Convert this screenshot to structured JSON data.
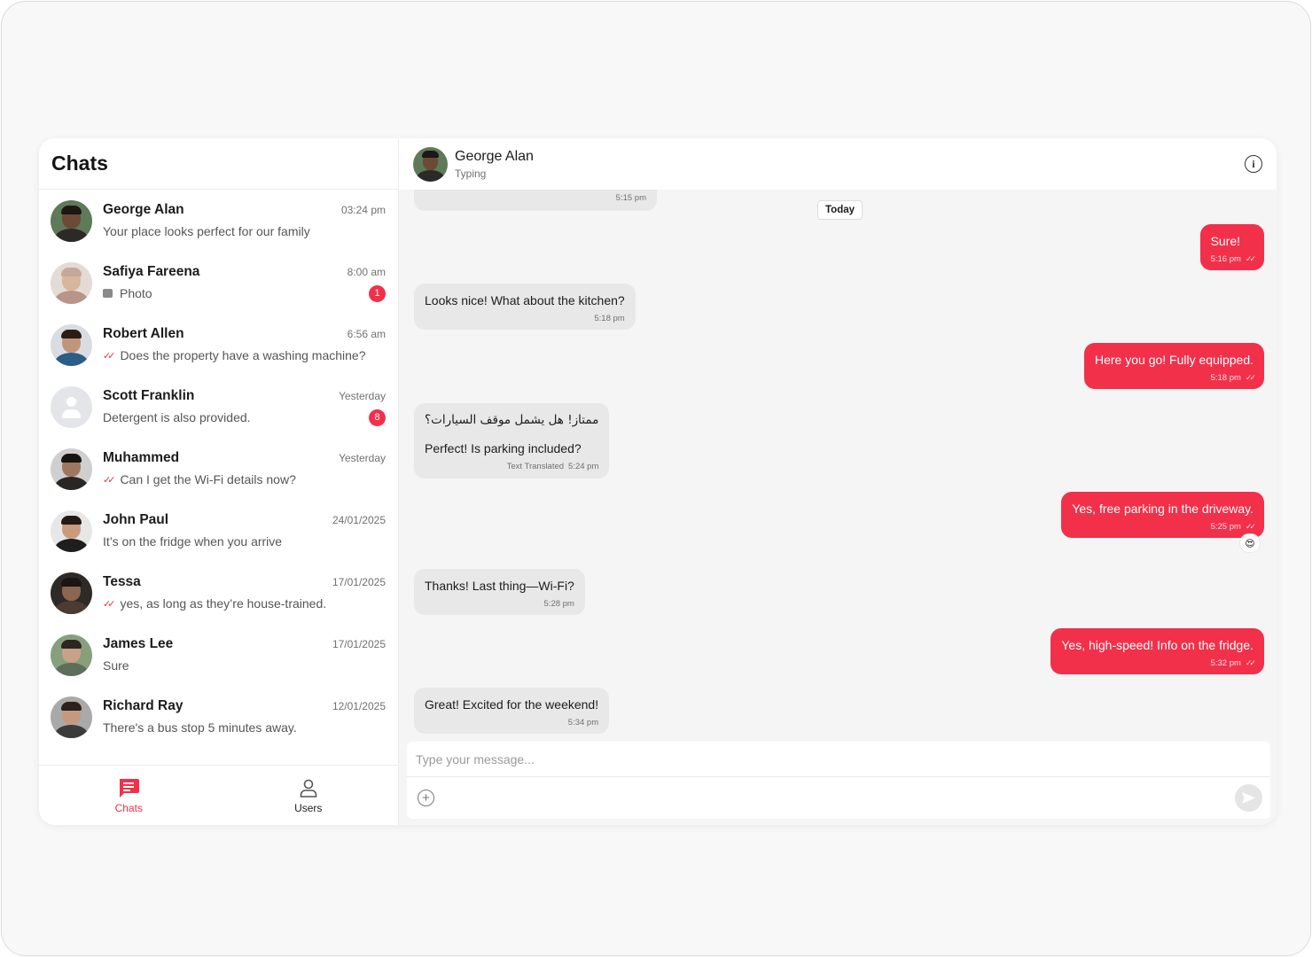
{
  "sidebar": {
    "title": "Chats",
    "chats": [
      {
        "name": "George Alan",
        "time": "03:24 pm",
        "preview": "Your place looks perfect for our family",
        "badge": "",
        "sent": false,
        "photo": false,
        "skin": "#6b4a36",
        "hair": "#1e1714",
        "shirt": "#2c2a28",
        "bg": "#5e7a58"
      },
      {
        "name": "Safiya Fareena",
        "time": "8:00 am",
        "preview": "Photo",
        "badge": "1",
        "sent": false,
        "photo": true,
        "skin": "#d8b59c",
        "hair": "#c7a79a",
        "shirt": "#b99589",
        "bg": "#e3dbd6"
      },
      {
        "name": "Robert Allen",
        "time": "6:56 am",
        "preview": "Does the property have a washing machine?",
        "badge": "",
        "sent": true,
        "photo": false,
        "skin": "#c0957a",
        "hair": "#2a1d16",
        "shirt": "#2b5d86",
        "bg": "#d9dde2"
      },
      {
        "name": "Scott Franklin",
        "time": "Yesterday",
        "preview": "Detergent is also provided.",
        "badge": "8",
        "sent": false,
        "photo": false,
        "placeholder": true
      },
      {
        "name": "Muhammed",
        "time": "Yesterday",
        "preview": "Can I get the Wi-Fi details now?",
        "badge": "",
        "sent": true,
        "photo": false,
        "skin": "#9e7761",
        "hair": "#171412",
        "shirt": "#2a2624",
        "bg": "#cfcfcf"
      },
      {
        "name": "John Paul",
        "time": "24/01/2025",
        "preview": "It’s on the fridge when you arrive",
        "badge": "",
        "sent": false,
        "photo": false,
        "skin": "#c99b7d",
        "hair": "#231a15",
        "shirt": "#1e1e1e",
        "bg": "#e7e7e7"
      },
      {
        "name": "Tessa",
        "time": "17/01/2025",
        "preview": "yes, as long as they’re house-trained.",
        "badge": "",
        "sent": true,
        "photo": false,
        "skin": "#8d6650",
        "hair": "#1a1412",
        "shirt": "#4a3b33",
        "bg": "#2e2a28"
      },
      {
        "name": "James Lee",
        "time": "17/01/2025",
        "preview": "Sure",
        "badge": "",
        "sent": false,
        "photo": false,
        "skin": "#c9a186",
        "hair": "#2c2520",
        "shirt": "#5d6e5a",
        "bg": "#86a07e"
      },
      {
        "name": "Richard Ray",
        "time": "12/01/2025",
        "preview": "There's a bus stop 5 minutes away.",
        "badge": "",
        "sent": false,
        "photo": false,
        "skin": "#c49a7e",
        "hair": "#2a211c",
        "shirt": "#3b3b3b",
        "bg": "#a9a9a9"
      }
    ]
  },
  "nav": {
    "chats_label": "Chats",
    "users_label": "Users"
  },
  "conversation": {
    "name": "George Alan",
    "status": "Typing",
    "date_chip": "Today",
    "messages": [
      {
        "dir": "in",
        "time": "5:15 pm",
        "text": ""
      },
      {
        "dir": "out",
        "text": "Sure!",
        "time": "5:16 pm"
      },
      {
        "dir": "in",
        "text": "Looks nice! What about the kitchen?",
        "time": "5:18 pm"
      },
      {
        "dir": "out",
        "text": "Here you go! Fully equipped.",
        "time": "5:18 pm"
      },
      {
        "dir": "in",
        "original": "ممتاز! هل يشمل موقف السيارات؟",
        "text": "Perfect! Is parking included?",
        "translated_label": "Text Translated",
        "time": "5:24 pm"
      },
      {
        "dir": "out",
        "text": "Yes, free parking in the driveway.",
        "time": "5:25 pm",
        "reaction": "😍"
      },
      {
        "dir": "in",
        "text": "Thanks! Last thing—Wi-Fi?",
        "time": "5:28 pm"
      },
      {
        "dir": "out",
        "text": "Yes, high-speed! Info on the fridge.",
        "time": "5:32 pm"
      },
      {
        "dir": "in",
        "text": "Great! Excited for the weekend!",
        "time": "5:34 pm"
      }
    ]
  },
  "composer": {
    "placeholder": "Type your message..."
  },
  "colors": {
    "accent": "#f2304a",
    "incoming_bubble": "#e8e8e8",
    "background": "#f5f5f5"
  },
  "icons": {
    "info": "info-icon",
    "attach": "plus-circle-icon",
    "send": "send-icon",
    "chats_nav": "chat-bubble-icon",
    "users_nav": "user-icon",
    "read_receipt": "double-check-icon",
    "photo": "image-icon"
  }
}
